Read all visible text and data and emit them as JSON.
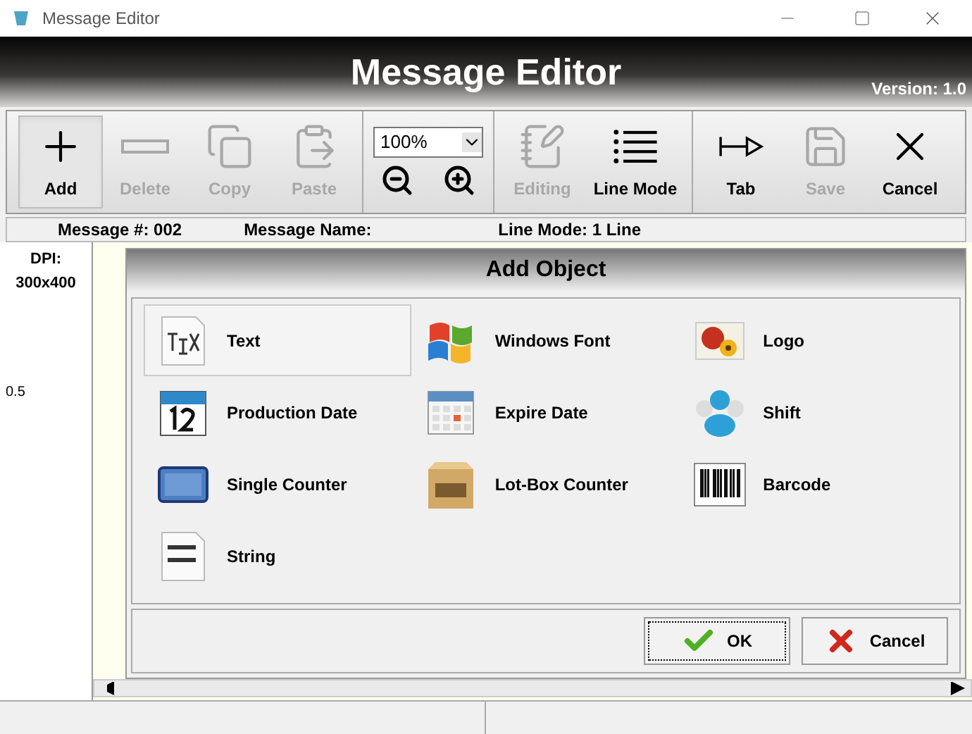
{
  "window": {
    "title": "Message Editor"
  },
  "header": {
    "title": "Message Editor",
    "version": "Version: 1.0"
  },
  "toolbar": {
    "groups": [
      [
        {
          "kind": "add",
          "label": "Add",
          "selected": true,
          "disabled": false
        },
        {
          "kind": "delete",
          "label": "Delete",
          "selected": false,
          "disabled": true
        },
        {
          "kind": "copy",
          "label": "Copy",
          "selected": false,
          "disabled": true
        },
        {
          "kind": "paste",
          "label": "Paste",
          "selected": false,
          "disabled": true
        }
      ],
      [
        {
          "kind": "zoom",
          "value": "100%"
        }
      ],
      [
        {
          "kind": "editing",
          "label": "Editing",
          "selected": false,
          "disabled": true
        },
        {
          "kind": "linemode",
          "label": "Line Mode",
          "selected": false,
          "disabled": false
        }
      ],
      [
        {
          "kind": "tab",
          "label": "Tab",
          "selected": false,
          "disabled": false
        },
        {
          "kind": "save",
          "label": "Save",
          "selected": false,
          "disabled": true
        },
        {
          "kind": "cancel",
          "label": "Cancel",
          "selected": false,
          "disabled": false
        }
      ]
    ]
  },
  "info_bar": [
    "Message #: 002",
    "Message Name:",
    "Line Mode: 1 Line"
  ],
  "ruler": {
    "dpi_label": "DPI:",
    "dpi": "300x400",
    "mark": "0.5"
  },
  "dialog": {
    "title": "Add Object",
    "objects": [
      {
        "kind": "tex",
        "label": "Text",
        "selected": true
      },
      {
        "kind": "windows",
        "label": "Windows Font",
        "selected": false
      },
      {
        "kind": "logo",
        "label": "Logo",
        "selected": false
      },
      {
        "kind": "calendar",
        "label": "Production Date",
        "selected": false
      },
      {
        "kind": "grid",
        "label": "Expire Date",
        "selected": false
      },
      {
        "kind": "people",
        "label": "Shift",
        "selected": false
      },
      {
        "kind": "counter",
        "label": "Single Counter",
        "selected": false
      },
      {
        "kind": "crate",
        "label": "Lot-Box Counter",
        "selected": false
      },
      {
        "kind": "barcode",
        "label": "Barcode",
        "selected": false
      },
      {
        "kind": "string",
        "label": "String",
        "selected": false
      }
    ],
    "buttons": [
      {
        "kind": "ok",
        "label": "OK",
        "focused": true
      },
      {
        "kind": "cancel",
        "label": "Cancel",
        "focused": false
      }
    ]
  }
}
